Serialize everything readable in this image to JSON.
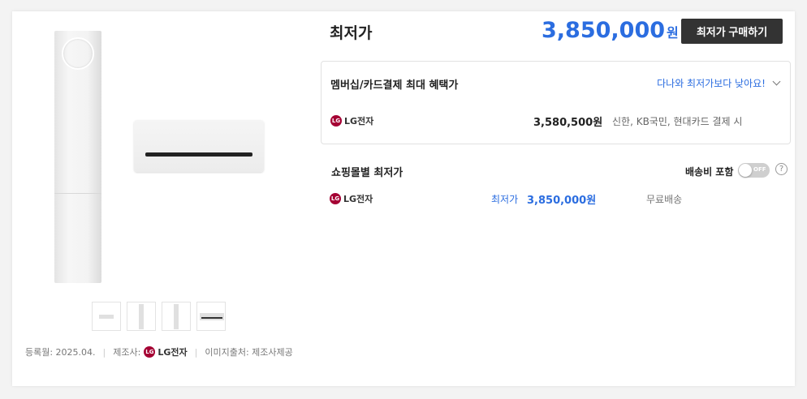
{
  "summary": {
    "title": "최저가",
    "price": "3,850,000",
    "currency": "원",
    "buy_label": "최저가 구매하기"
  },
  "benefit": {
    "title": "멤버십/카드결제 최대 혜택가",
    "link": "다나와 최저가보다 낮아요!",
    "row": {
      "seller": "LG전자",
      "price": "3,580,500원",
      "note": "신한, KB국민, 현대카드 결제 시"
    }
  },
  "malls": {
    "title": "쇼핑몰별 최저가",
    "shipping_toggle_label": "배송비 포함",
    "toggle_state": "OFF",
    "help": "?",
    "row": {
      "seller": "LG전자",
      "label": "최저가",
      "price": "3,850,000원",
      "shipping": "무료배송"
    }
  },
  "meta": {
    "registered": "등록월: 2025.04.",
    "maker_label": "제조사:",
    "maker": "LG전자",
    "image_source": "이미지출처: 제조사제공"
  },
  "logo": {
    "mark": "LG",
    "brand_color": "#a50034"
  },
  "colors": {
    "accent": "#2b6de0",
    "button": "#333333"
  }
}
